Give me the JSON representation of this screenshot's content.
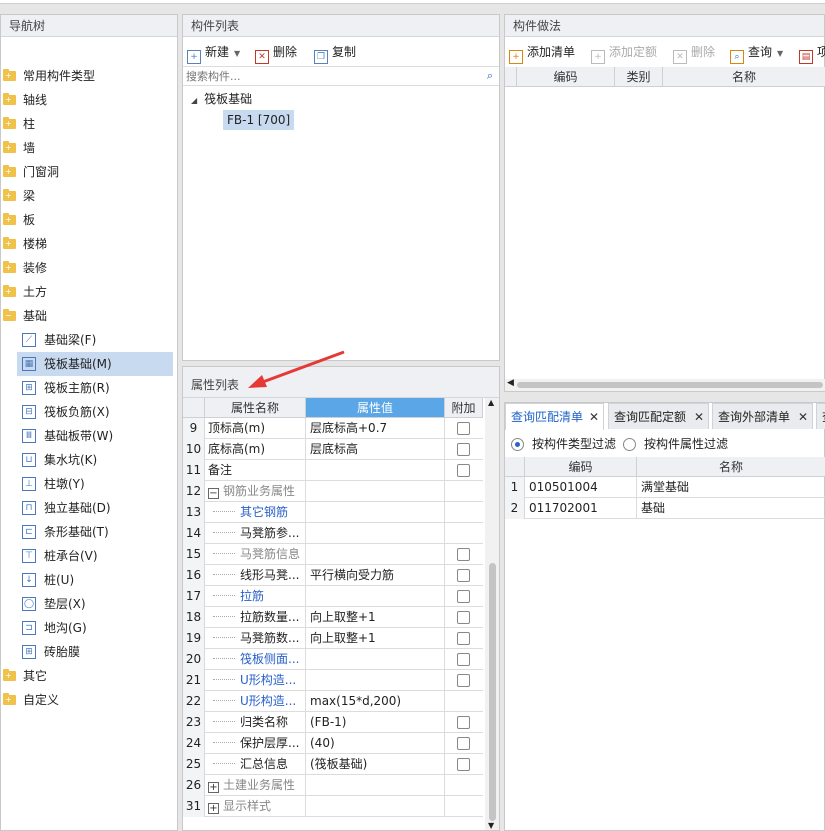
{
  "nav": {
    "title": "导航树",
    "items": [
      {
        "label": "常用构件类型"
      },
      {
        "label": "轴线"
      },
      {
        "label": "柱"
      },
      {
        "label": "墙"
      },
      {
        "label": "门窗洞"
      },
      {
        "label": "梁"
      },
      {
        "label": "板"
      },
      {
        "label": "楼梯"
      },
      {
        "label": "装修"
      },
      {
        "label": "土方"
      },
      {
        "label": "基础"
      }
    ],
    "sub_items": [
      {
        "label": "基础梁(F)",
        "icon": "beam-icon"
      },
      {
        "label": "筏板基础(M)",
        "icon": "raft-icon"
      },
      {
        "label": "筏板主筋(R)",
        "icon": "rebar-icon"
      },
      {
        "label": "筏板负筋(X)",
        "icon": "neg-rebar-icon"
      },
      {
        "label": "基础板带(W)",
        "icon": "strip-icon"
      },
      {
        "label": "集水坑(K)",
        "icon": "pit-icon"
      },
      {
        "label": "柱墩(Y)",
        "icon": "pier-icon"
      },
      {
        "label": "独立基础(D)",
        "icon": "isolated-footing-icon"
      },
      {
        "label": "条形基础(T)",
        "icon": "strip-footing-icon"
      },
      {
        "label": "桩承台(V)",
        "icon": "pile-cap-icon"
      },
      {
        "label": "桩(U)",
        "icon": "pile-icon"
      },
      {
        "label": "垫层(X)",
        "icon": "cushion-icon"
      },
      {
        "label": "地沟(G)",
        "icon": "trench-icon"
      },
      {
        "label": "砖胎膜",
        "icon": "brick-mold-icon"
      }
    ],
    "tail_items": [
      {
        "label": "其它"
      },
      {
        "label": "自定义"
      }
    ]
  },
  "component_list": {
    "title": "构件列表",
    "new_label": "新建",
    "delete_label": "删除",
    "copy_label": "复制",
    "search_placeholder": "搜索构件...",
    "tree_root": "筏板基础",
    "tree_child": "FB-1 [700]"
  },
  "properties": {
    "title": "属性列表",
    "col_name": "属性名称",
    "col_value": "属性值",
    "col_extra": "附加",
    "rows": [
      {
        "num": "9",
        "name": "顶标高(m)",
        "value": "层底标高+0.7",
        "style": "plain",
        "check": true
      },
      {
        "num": "10",
        "name": "底标高(m)",
        "value": "层底标高",
        "style": "plain",
        "check": true
      },
      {
        "num": "11",
        "name": "备注",
        "value": "",
        "style": "plain",
        "check": true
      },
      {
        "num": "12",
        "name": "钢筋业务属性",
        "value": "",
        "style": "group",
        "check": false
      },
      {
        "num": "13",
        "name": "其它钢筋",
        "value": "",
        "style": "blue",
        "check": false
      },
      {
        "num": "14",
        "name": "马凳筋参...",
        "value": "",
        "style": "child",
        "check": false
      },
      {
        "num": "15",
        "name": "马凳筋信息",
        "value": "",
        "style": "gray",
        "check": true
      },
      {
        "num": "16",
        "name": "线形马凳...",
        "value": "平行横向受力筋",
        "style": "child",
        "check": true
      },
      {
        "num": "17",
        "name": "拉筋",
        "value": "",
        "style": "blue",
        "check": true
      },
      {
        "num": "18",
        "name": "拉筋数量...",
        "value": "向上取整+1",
        "style": "child",
        "check": true
      },
      {
        "num": "19",
        "name": "马凳筋数...",
        "value": "向上取整+1",
        "style": "child",
        "check": true
      },
      {
        "num": "20",
        "name": "筏板侧面...",
        "value": "",
        "style": "blue",
        "check": true
      },
      {
        "num": "21",
        "name": "U形构造...",
        "value": "",
        "style": "blue",
        "check": true
      },
      {
        "num": "22",
        "name": "U形构造...",
        "value": "max(15*d,200)",
        "style": "blue",
        "check": false
      },
      {
        "num": "23",
        "name": "归类名称",
        "value": "(FB-1)",
        "style": "child",
        "check": true
      },
      {
        "num": "24",
        "name": "保护层厚...",
        "value": "(40)",
        "style": "child",
        "check": true
      },
      {
        "num": "25",
        "name": "汇总信息",
        "value": "(筏板基础)",
        "style": "child",
        "check": true
      },
      {
        "num": "26",
        "name": "土建业务属性",
        "value": "",
        "style": "groupc",
        "check": false
      },
      {
        "num": "31",
        "name": "显示样式",
        "value": "",
        "style": "groupc",
        "check": false
      }
    ]
  },
  "method": {
    "title": "构件做法",
    "add_list": "添加清单",
    "add_quota": "添加定额",
    "delete": "删除",
    "query": "查询",
    "more": "项",
    "col_code": "编码",
    "col_type": "类别",
    "col_name": "名称"
  },
  "query": {
    "tab1": "查询匹配清单",
    "tab2": "查询匹配定额",
    "tab3": "查询外部清单",
    "tab4": "查",
    "filter1": "按构件类型过滤",
    "filter2": "按构件属性过滤",
    "col_code": "编码",
    "col_name": "名称",
    "rows": [
      {
        "num": "1",
        "code": "010501004",
        "name": "满堂基础"
      },
      {
        "num": "2",
        "code": "011702001",
        "name": "基础"
      }
    ]
  },
  "colors": {
    "accent": "#2a62c9",
    "selection": "#c8daf0",
    "arrow": "#e53935"
  }
}
